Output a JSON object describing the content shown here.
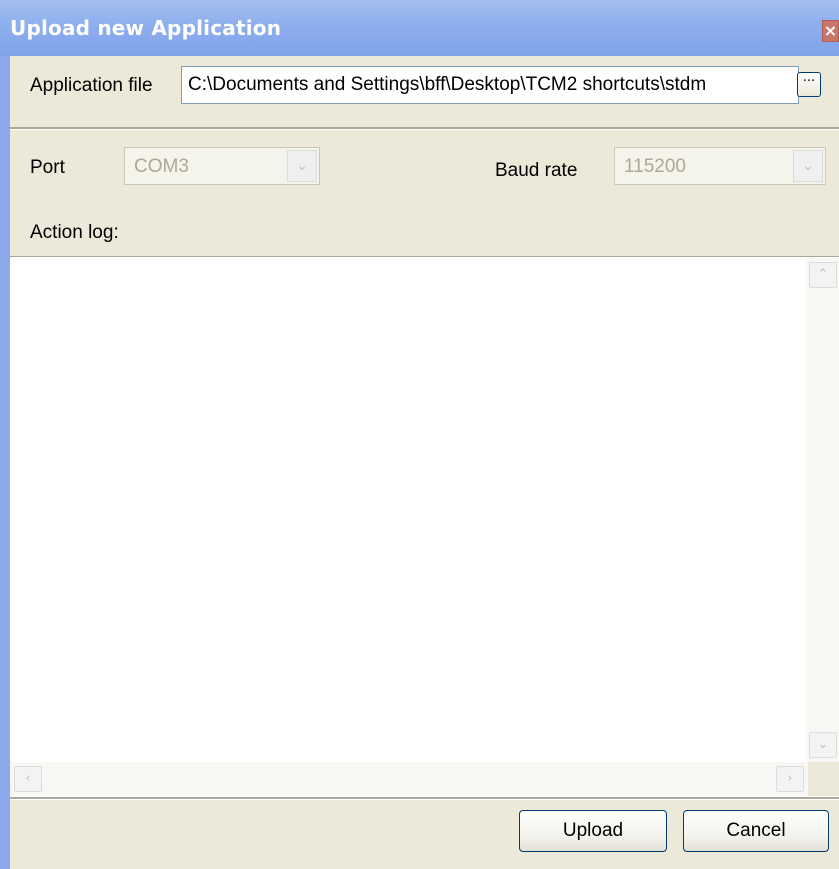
{
  "window": {
    "title": "Upload new Application",
    "close_glyph": "×"
  },
  "application_file": {
    "label": "Application file",
    "value": "C:\\Documents and Settings\\bff\\Desktop\\TCM2 shortcuts\\stdm",
    "browse_glyph": "···"
  },
  "port": {
    "label": "Port",
    "selected": "COM3",
    "disabled": true
  },
  "baud_rate": {
    "label": "Baud rate",
    "selected": "115200",
    "disabled": true
  },
  "action_log": {
    "label": "Action log:",
    "content": ""
  },
  "scrollbars": {
    "up_glyph": "⌃",
    "down_glyph": "⌄",
    "left_glyph": "‹",
    "right_glyph": "›"
  },
  "buttons": {
    "upload_label": "Upload",
    "cancel_label": "Cancel"
  },
  "icons": {
    "close": "close-icon",
    "browse": "ellipsis-icon",
    "dropdown": "chevron-down-icon"
  },
  "colors": {
    "titlebar": "#8fb0ee",
    "dialog_background": "#ece9d8",
    "close_button": "#c9776c",
    "button_border": "#003c74"
  }
}
